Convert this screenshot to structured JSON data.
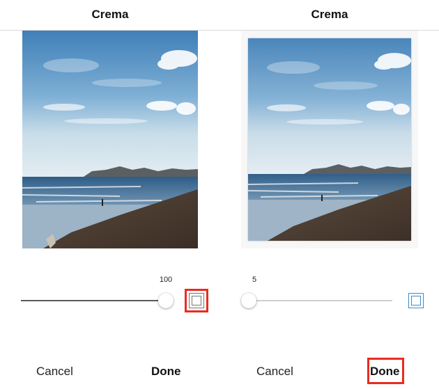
{
  "left_panel": {
    "title": "Crema",
    "slider_value": "100",
    "slider_fraction": 1.0,
    "cancel_label": "Cancel",
    "done_label": "Done"
  },
  "right_panel": {
    "title": "Crema",
    "slider_value": "5",
    "slider_fraction": 0.05,
    "cancel_label": "Cancel",
    "done_label": "Done"
  },
  "icons": {
    "border_toggle": "frame-border-icon"
  },
  "colors": {
    "highlight": "#ea2b1f",
    "toggle_active": "#3b8bc8",
    "toggle_inactive": "#777777"
  }
}
